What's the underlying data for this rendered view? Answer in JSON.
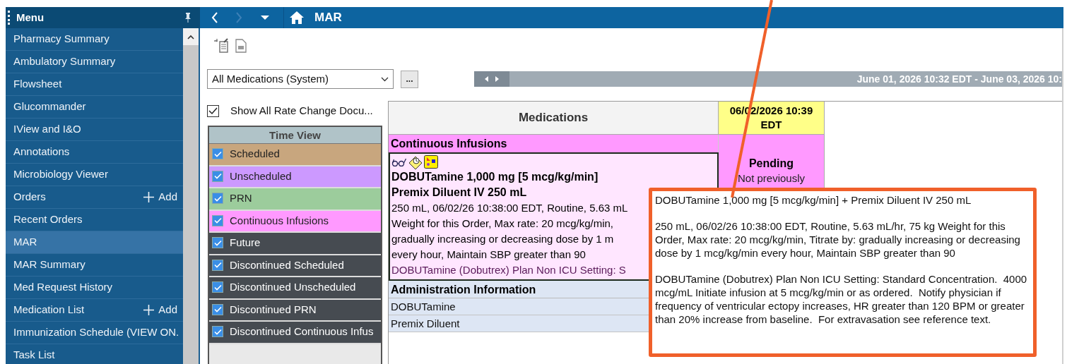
{
  "sidebar": {
    "title": "Menu",
    "items": [
      {
        "label": "Pharmacy Summary",
        "selected": false
      },
      {
        "label": "Ambulatory Summary",
        "selected": false
      },
      {
        "label": "Flowsheet",
        "selected": false
      },
      {
        "label": "Glucommander",
        "selected": false
      },
      {
        "label": "IView and I&O",
        "selected": false
      },
      {
        "label": "Annotations",
        "selected": false
      },
      {
        "label": "Microbiology Viewer",
        "selected": false
      },
      {
        "label": "Orders",
        "selected": false,
        "action": "Add"
      },
      {
        "label": "Recent Orders",
        "selected": false
      },
      {
        "label": "MAR",
        "selected": true
      },
      {
        "label": "MAR Summary",
        "selected": false
      },
      {
        "label": "Med Request History",
        "selected": false
      },
      {
        "label": "Medication List",
        "selected": false,
        "action": "Add"
      },
      {
        "label": "Immunization Schedule (VIEW ON.",
        "selected": false
      },
      {
        "label": "Task List",
        "selected": false
      }
    ]
  },
  "header": {
    "title": "MAR",
    "forward_disabled": true
  },
  "filter": {
    "value": "All Medications (System)",
    "more_button": "..."
  },
  "timeline": {
    "range": "June 01, 2026 10:32 EDT - June 03, 2026 10:"
  },
  "show_rate_changes": {
    "label": "Show All Rate Change Docu...",
    "checked": true
  },
  "time_view": {
    "title": "Time View",
    "items": [
      {
        "label": "Scheduled",
        "checked": true,
        "color": "#c8a67e"
      },
      {
        "label": "Unscheduled",
        "checked": true,
        "color": "#cc99ff"
      },
      {
        "label": "PRN",
        "checked": true,
        "color": "#9ccc9c"
      },
      {
        "label": "Continuous Infusions",
        "checked": true,
        "color": "#ff99ff"
      },
      {
        "label": "Future",
        "checked": true,
        "color": "#464b51"
      },
      {
        "label": "Discontinued Scheduled",
        "checked": true,
        "color": "#464b51"
      },
      {
        "label": "Discontinued Unscheduled",
        "checked": true,
        "color": "#464b51"
      },
      {
        "label": "Discontinued PRN",
        "checked": true,
        "color": "#464b51"
      },
      {
        "label": "Discontinued Continuous Infus",
        "checked": true,
        "color": "#464b51"
      }
    ]
  },
  "table": {
    "columns": [
      "Medications",
      "06/02/2026 10:39 EDT"
    ],
    "section": "Continuous Infusions",
    "order": {
      "name_lines": [
        "DOBUTamine 1,000 mg [5 mcg/kg/min]",
        "Premix Diluent IV 250 mL"
      ],
      "detail_lines": [
        "250 mL, 06/02/26 10:38:00 EDT, Routine, 5.63 mL",
        "Weight for this Order, Max rate: 20 mcg/kg/min,",
        "gradually increasing or decreasing dose by 1 m",
        "every hour, Maintain SBP greater than 90"
      ],
      "comment": "DOBUTamine (Dobutrex) Plan Non ICU Setting: S",
      "status": "Pending",
      "status_note": "Not previously"
    },
    "admin_title": "Administration Information",
    "admin_rows": [
      "DOBUTamine",
      "Premix Diluent"
    ]
  },
  "tooltip": {
    "paragraphs": [
      "DOBUTamine 1,000 mg [5 mcg/kg/min] + Premix Diluent IV 250 mL",
      "250 mL, 06/02/26 10:38:00 EDT, Routine, 5.63 mL/hr, 75 kg Weight for this Order, Max rate: 20 mcg/kg/min, Titrate by: gradually increasing or decreasing dose by 1 mcg/kg/min every hour, Maintain SBP greater than 90",
      "DOBUTamine (Dobutrex) Plan Non ICU Setting: Standard Concentration.  4000 mcg/mL Initiate infusion at 5 mcg/kg/min or as ordered.  Notify physician if frequency of ventricular ectopy increases, HR greater than 120 BPM or greater than 20% increase from baseline.  For extravasation see reference text."
    ]
  }
}
